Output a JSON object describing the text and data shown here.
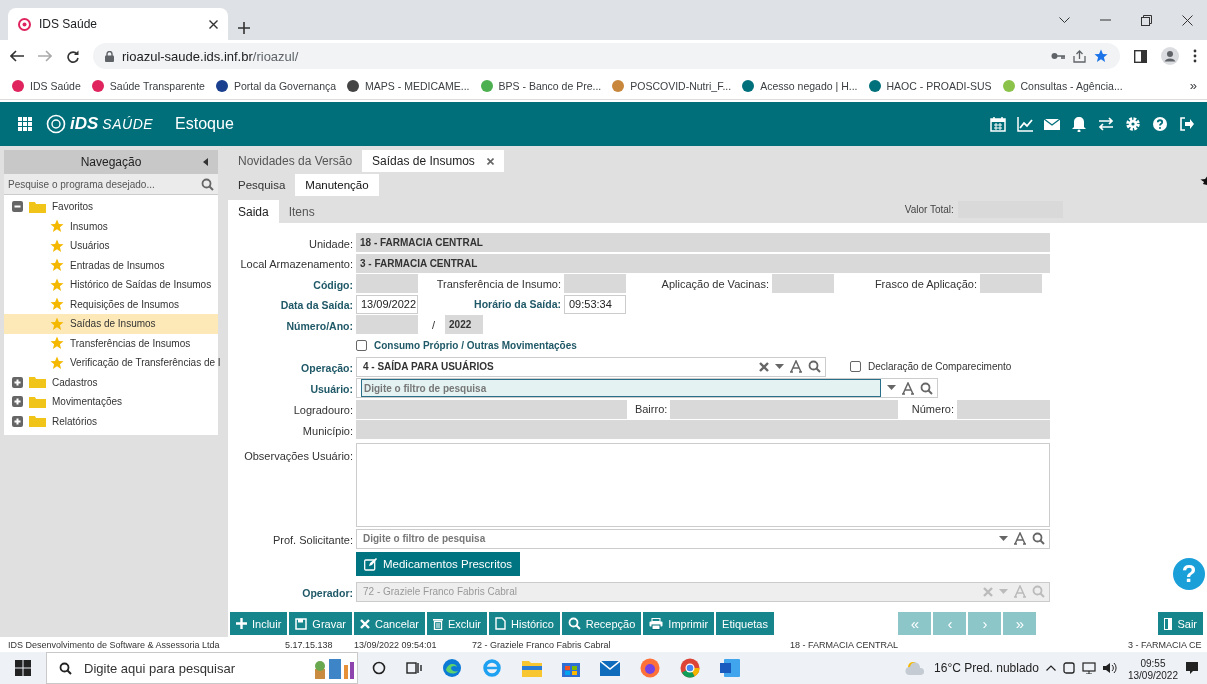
{
  "browser": {
    "tab_title": "IDS Saúde",
    "url_host": "rioazul-saude.ids.inf.br",
    "url_path": "/rioazul/",
    "bookmarks_more": "»",
    "bookmarks": [
      {
        "label": "IDS Saúde",
        "color": "#e0245e"
      },
      {
        "label": "Saúde Transparente",
        "color": "#e0245e"
      },
      {
        "label": "Portal da Governança",
        "color": "#1a3f8f"
      },
      {
        "label": "MAPS - MEDICAME...",
        "color": "#444444"
      },
      {
        "label": "BPS - Banco de Pre...",
        "color": "#4caf50"
      },
      {
        "label": "POSCOVID-Nutri_F...",
        "color": "#c8873a"
      },
      {
        "label": "Acesso negado | H...",
        "color": "#00707a"
      },
      {
        "label": "HAOC - PROADI-SUS",
        "color": "#00707a"
      },
      {
        "label": "Consultas - Agência...",
        "color": "#8bc34a"
      }
    ]
  },
  "app": {
    "brand": "iDS",
    "brand_sub": "SAÚDE",
    "module": "Estoque"
  },
  "nav": {
    "title": "Navegação",
    "search_placeholder": "Pesquise o programa desejado...",
    "tree": [
      {
        "label": "Favoritos",
        "expanded": true,
        "selected": false,
        "children": [
          {
            "label": "Insumos",
            "selected": false
          },
          {
            "label": "Usuários",
            "selected": false
          },
          {
            "label": "Entradas de Insumos",
            "selected": false
          },
          {
            "label": "Histórico de Saídas de Insumos",
            "selected": false
          },
          {
            "label": "Requisições de Insumos",
            "selected": false
          },
          {
            "label": "Saídas de Insumos",
            "selected": true
          },
          {
            "label": "Transferências de Insumos",
            "selected": false
          },
          {
            "label": "Verificação de Transferências de I",
            "selected": false
          }
        ]
      },
      {
        "label": "Cadastros",
        "expanded": false,
        "selected": false
      },
      {
        "label": "Movimentações",
        "expanded": false,
        "selected": false
      },
      {
        "label": "Relatórios",
        "expanded": false,
        "selected": false
      }
    ]
  },
  "page_tabs": [
    {
      "label": "Novidades da Versão",
      "selected": false,
      "closable": false
    },
    {
      "label": "Saídas de Insumos",
      "selected": true,
      "closable": true
    }
  ],
  "mode_tabs": [
    {
      "label": "Pesquisa",
      "selected": false
    },
    {
      "label": "Manutenção",
      "selected": true
    }
  ],
  "form_tabs": [
    {
      "label": "Saida",
      "selected": true
    },
    {
      "label": "Itens",
      "selected": false
    }
  ],
  "valor_total": {
    "label": "Valor Total:"
  },
  "form": {
    "rows": [
      {
        "fields": [
          {
            "kind": "field",
            "label": "Unidade:",
            "strong": false,
            "readonly": true,
            "value": "18 - FARMACIA CENTRAL"
          }
        ]
      },
      {
        "fields": [
          {
            "kind": "field",
            "label": "Local Armazenamento:",
            "strong": false,
            "readonly": true,
            "value": "3 - FARMACIA CENTRAL"
          }
        ]
      },
      {
        "fields": [
          {
            "kind": "short",
            "label": "Código:",
            "strong": true,
            "readonly": true
          },
          {
            "kind": "short",
            "label": "Transferência de Insumo:",
            "strong": false,
            "readonly": true
          },
          {
            "kind": "short",
            "label": "Aplicação de Vacinas:",
            "strong": false,
            "readonly": true
          },
          {
            "kind": "short",
            "label": "Frasco de Aplicação:",
            "strong": false,
            "readonly": true
          }
        ]
      },
      {
        "fields": [
          {
            "kind": "short",
            "label": "Data da Saída:",
            "strong": true,
            "readonly": false,
            "value": "13/09/2022"
          },
          {
            "kind": "short",
            "label": "Horário da Saída:",
            "strong": true,
            "readonly": false,
            "value": "09:53:34"
          }
        ]
      },
      {
        "fields": [
          {
            "kind": "short",
            "label": "Número/Ano:",
            "strong": true,
            "readonly": true
          },
          {
            "kind": "separator",
            "text": "/"
          },
          {
            "kind": "tiny",
            "readonly": true,
            "value": "2022"
          }
        ]
      },
      {
        "fields": [
          {
            "kind": "checkbox",
            "label": "Consumo Próprio / Outras Movimentações",
            "strong": true,
            "checked": false
          }
        ]
      },
      {
        "fields": [
          {
            "kind": "lookup-short",
            "label": "Operação:",
            "strong": true,
            "value": "4 - SAÍDA PARA USUÁRIOS",
            "clearable": true,
            "focused": false,
            "disabled": false
          },
          {
            "kind": "checkbox",
            "label": "Declaração de Comparecimento",
            "strong": false,
            "checked": false
          }
        ]
      },
      {
        "fields": [
          {
            "kind": "lookup-mid",
            "label": "Usuário:",
            "strong": true,
            "placeholder": "Digite o filtro de pesquisa",
            "clearable": false,
            "focused": true,
            "disabled": false
          }
        ]
      },
      {
        "fields": [
          {
            "kind": "field",
            "label": "Logradouro:",
            "strong": false,
            "readonly": true
          },
          {
            "kind": "field",
            "label": "Bairro:",
            "strong": false,
            "readonly": true
          },
          {
            "kind": "medium",
            "label": "Número:",
            "strong": false,
            "readonly": true
          }
        ]
      },
      {
        "fields": [
          {
            "kind": "field",
            "label": "Município:",
            "strong": false,
            "readonly": true
          }
        ]
      },
      {
        "fields": [
          {
            "kind": "textarea",
            "label": "Observações Usuário:",
            "strong": false,
            "readonly": false
          }
        ]
      },
      {
        "fields": [
          {
            "kind": "lookup",
            "label": "Prof. Solicitante:",
            "strong": false,
            "placeholder": "Digite o filtro de pesquisa",
            "clearable": false,
            "focused": false,
            "disabled": false
          }
        ]
      },
      {
        "fields": [
          {
            "kind": "button",
            "label": "Medicamentos Prescritos"
          }
        ]
      },
      {
        "fields": [
          {
            "kind": "lookup",
            "label": "Operador:",
            "strong": true,
            "value": "72 - Graziele Franco Fabris Cabral",
            "clearable": true,
            "focused": false,
            "disabled": true
          }
        ]
      }
    ]
  },
  "toolbar": {
    "buttons": [
      {
        "label": "Incluir"
      },
      {
        "label": "Gravar"
      },
      {
        "label": "Cancelar"
      },
      {
        "label": "Excluir"
      },
      {
        "label": "Histórico"
      },
      {
        "label": "Recepção"
      },
      {
        "label": "Imprimir"
      },
      {
        "label": "Etiquetas"
      }
    ],
    "pager": [
      {
        "label": "«",
        "disabled": true
      },
      {
        "label": "‹",
        "disabled": true
      },
      {
        "label": "›",
        "disabled": true
      },
      {
        "label": "»",
        "disabled": true
      }
    ],
    "exit": "Sair"
  },
  "help_button": "?",
  "status_bar": [
    "IDS Desenvolvimento de Software & Assessoria Ltda",
    "5.17.15.138",
    "13/09/2022 09:54:01",
    "72 - Graziele Franco Fabris Cabral",
    "18 - FARMACIA CENTRAL",
    "3 - FARMACIA CE"
  ],
  "taskbar": {
    "search_placeholder": "Digite aqui para pesquisar",
    "weather": "16°C Pred. nublado",
    "time": "09:55",
    "date": "13/09/2022"
  }
}
